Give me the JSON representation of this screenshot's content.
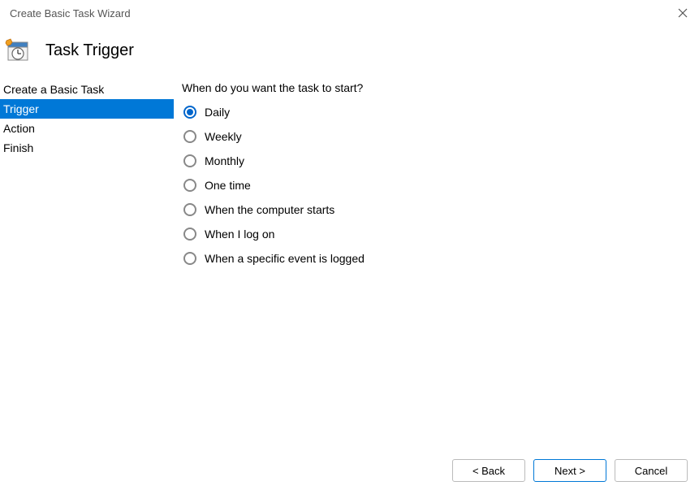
{
  "window": {
    "title": "Create Basic Task Wizard"
  },
  "header": {
    "title": "Task Trigger"
  },
  "sidebar": {
    "items": [
      {
        "label": "Create a Basic Task",
        "active": false
      },
      {
        "label": "Trigger",
        "active": true
      },
      {
        "label": "Action",
        "active": false
      },
      {
        "label": "Finish",
        "active": false
      }
    ]
  },
  "main": {
    "prompt": "When do you want the task to start?",
    "options": [
      {
        "label": "Daily",
        "checked": true
      },
      {
        "label": "Weekly",
        "checked": false
      },
      {
        "label": "Monthly",
        "checked": false
      },
      {
        "label": "One time",
        "checked": false
      },
      {
        "label": "When the computer starts",
        "checked": false
      },
      {
        "label": "When I log on",
        "checked": false
      },
      {
        "label": "When a specific event is logged",
        "checked": false
      }
    ]
  },
  "footer": {
    "back": "< Back",
    "next": "Next >",
    "cancel": "Cancel"
  }
}
